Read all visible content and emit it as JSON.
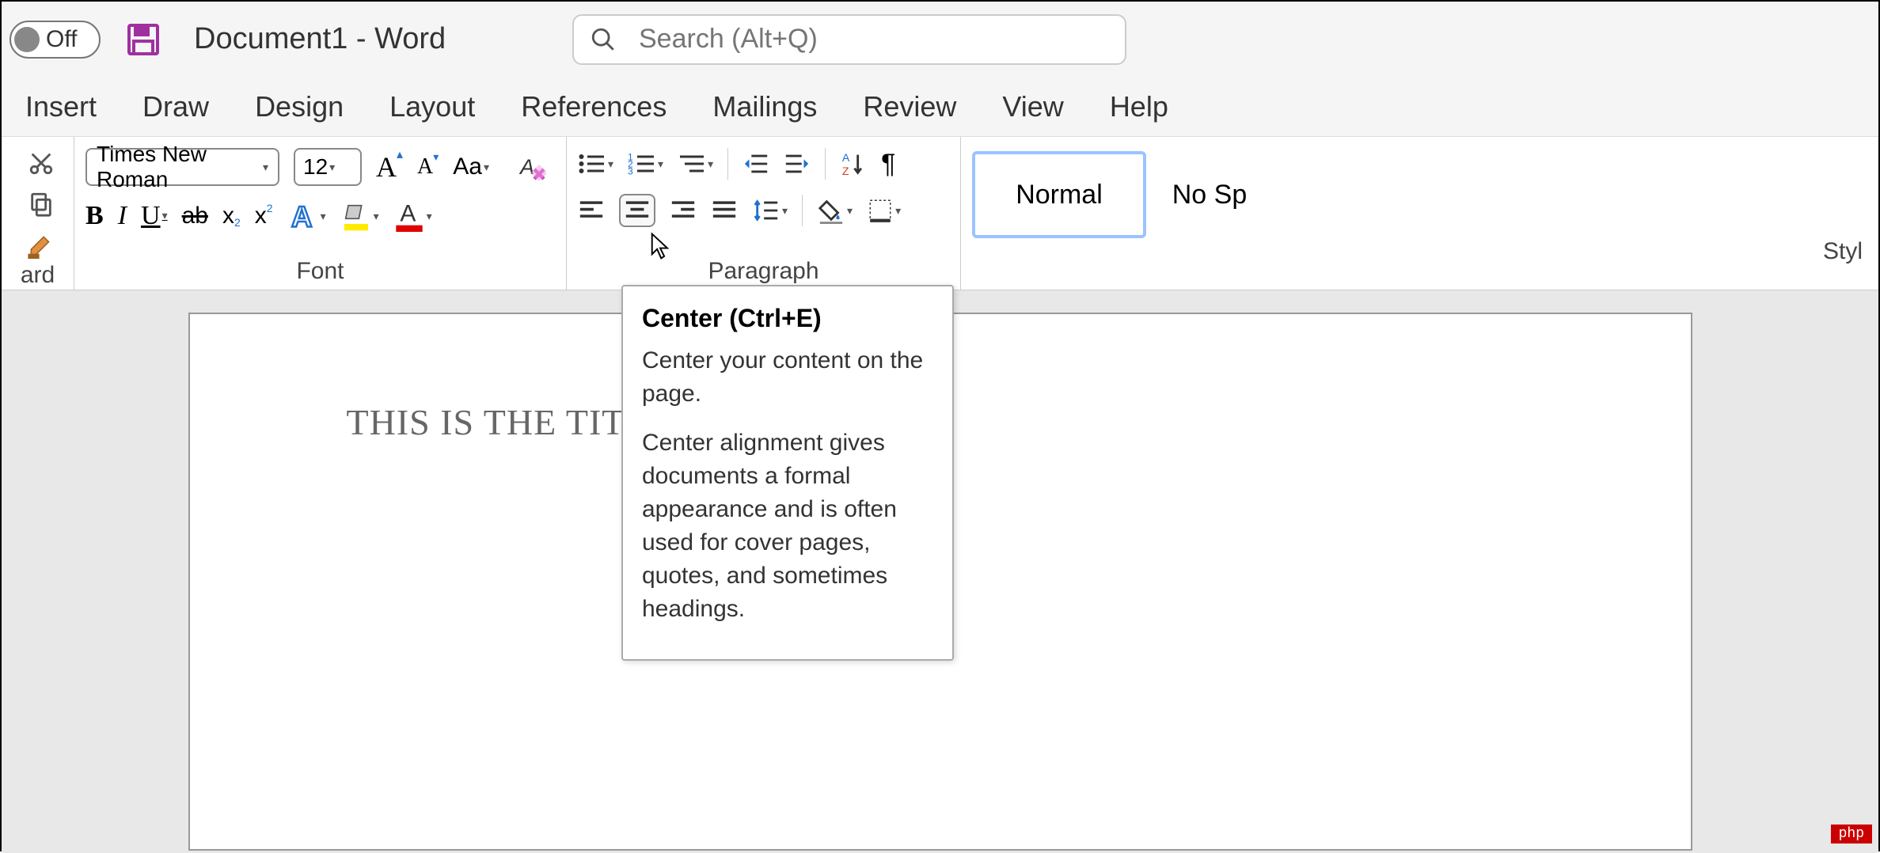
{
  "titlebar": {
    "toggle_label": "Off",
    "document_title": "Document1  -  Word"
  },
  "search": {
    "placeholder": "Search (Alt+Q)"
  },
  "tabs": [
    "Insert",
    "Draw",
    "Design",
    "Layout",
    "References",
    "Mailings",
    "Review",
    "View",
    "Help"
  ],
  "font": {
    "family": "Times New Roman",
    "size": "12",
    "group_label": "Font"
  },
  "clipboard": {
    "group_label": "ard"
  },
  "paragraph": {
    "group_label": "Paragraph"
  },
  "styles": {
    "normal": "Normal",
    "no_spacing": "No Sp",
    "group_label": "Styl"
  },
  "tooltip": {
    "title": "Center (Ctrl+E)",
    "line1": "Center your content on the page.",
    "line2": "Center alignment gives documents a formal appearance and is often used for cover pages, quotes, and sometimes headings."
  },
  "document": {
    "text": "THIS IS THE TITLE OF M"
  },
  "watermark": "php"
}
